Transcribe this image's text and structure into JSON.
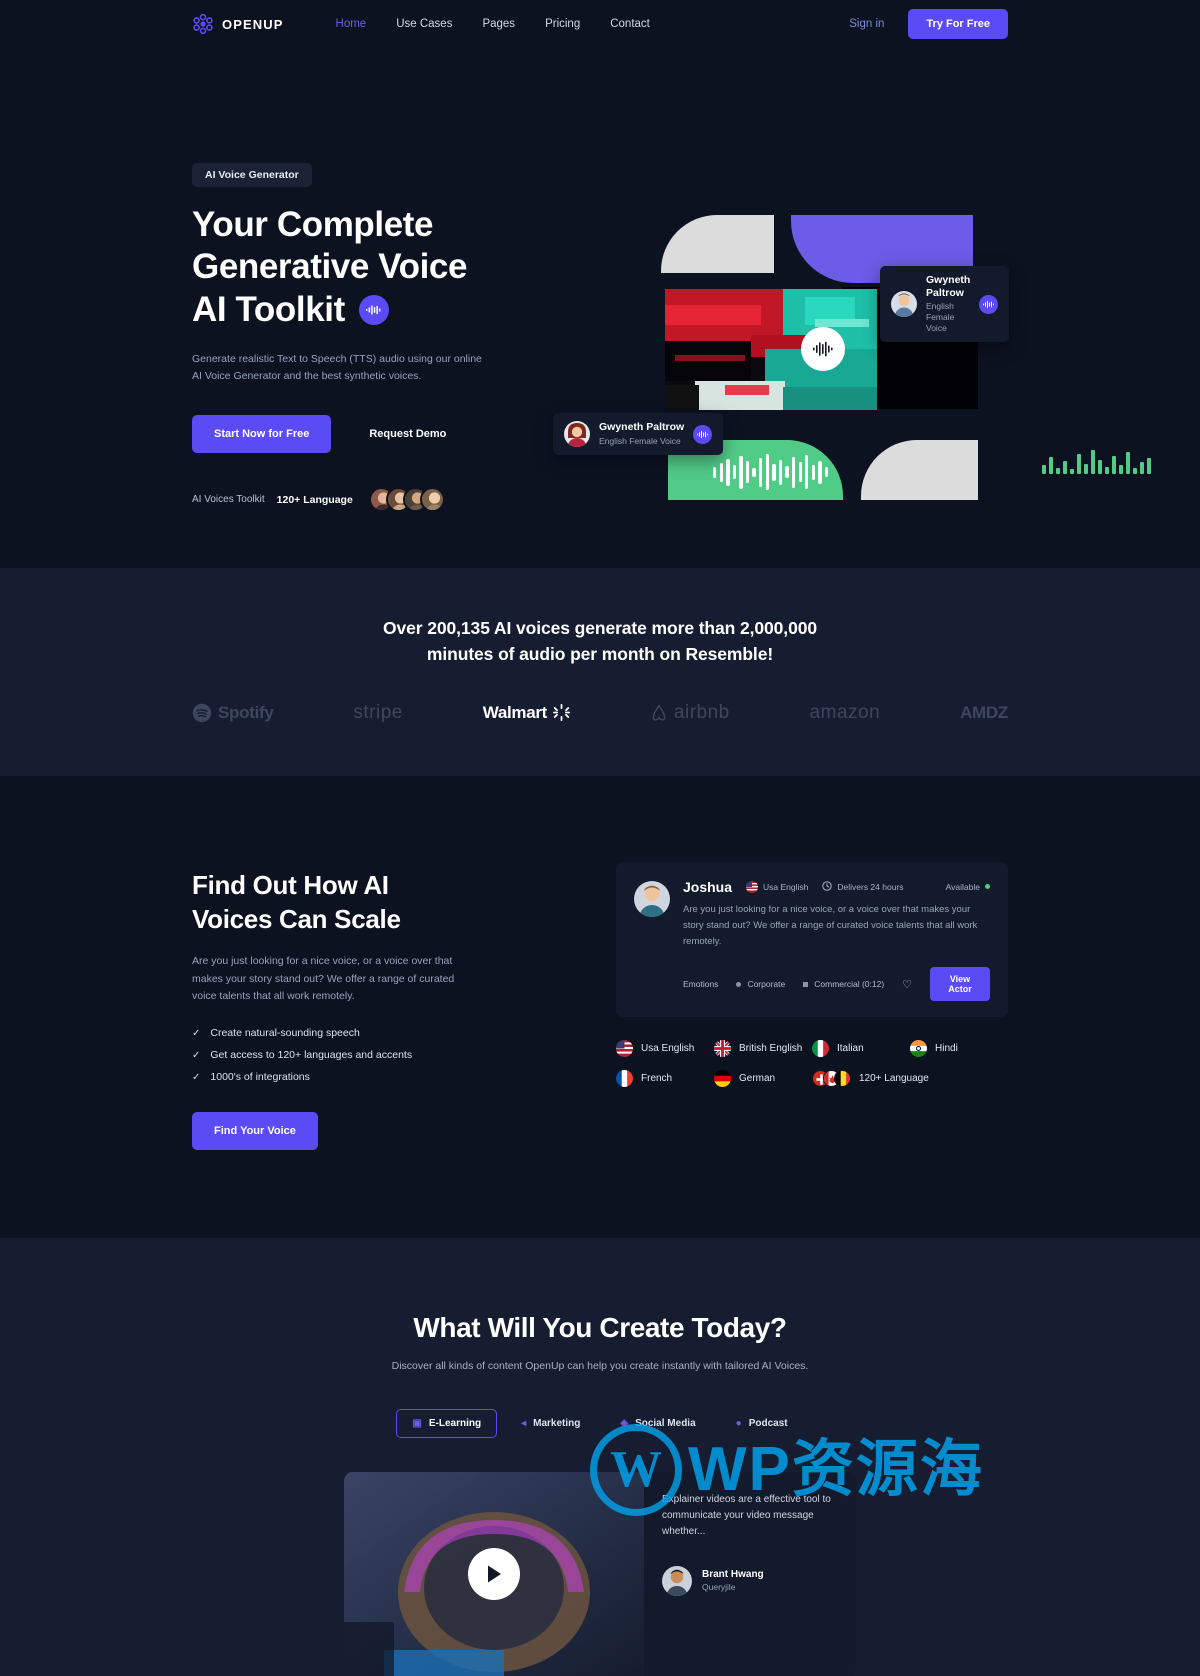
{
  "brand": {
    "name": "OPENUP",
    "logo_icon": "atom-logo-icon",
    "accent": "#5b4bf5"
  },
  "nav": {
    "links": [
      {
        "label": "Home",
        "active": true
      },
      {
        "label": "Use Cases",
        "active": false
      },
      {
        "label": "Pages",
        "active": false
      },
      {
        "label": "Pricing",
        "active": false
      },
      {
        "label": "Contact",
        "active": false
      }
    ],
    "signin_label": "Sign in",
    "cta_label": "Try For Free"
  },
  "hero": {
    "badge": "AI Voice Generator",
    "heading_line1": "Your Complete",
    "heading_line2": "Generative Voice",
    "heading_line3": "AI Toolkit",
    "heading_icon": "audio-wave-icon",
    "subtext": "Generate realistic Text to Speech (TTS) audio using our online AI Voice Generator and the best synthetic voices.",
    "primary_cta": "Start Now for Free",
    "secondary_cta": "Request Demo",
    "meta_label": "AI Voices Toolkit",
    "meta_value": "120+ Language",
    "voice_card_top": {
      "name": "Gwyneth Paltrow",
      "role": "English Female Voice",
      "icon": "audio-wave-icon"
    },
    "voice_card_bottom": {
      "name": "Gwyneth Paltrow",
      "role": "English Female Voice",
      "icon": "audio-wave-icon"
    },
    "play_icon": "audio-wave-play-icon"
  },
  "stats": {
    "line1": "Over 200,135 AI voices generate more than 2,000,000",
    "line2": "minutes of audio per month on Resemble!",
    "logos": [
      {
        "name": "Spotify",
        "highlight": false
      },
      {
        "name": "stripe",
        "highlight": false
      },
      {
        "name": "Walmart",
        "highlight": true
      },
      {
        "name": "airbnb",
        "highlight": false
      },
      {
        "name": "amazon",
        "highlight": false
      },
      {
        "name": "AMDZ",
        "highlight": false
      }
    ]
  },
  "scale": {
    "heading_line1": "Find Out How AI",
    "heading_line2": "Voices Can Scale",
    "paragraph": "Are you just looking for a nice voice, or a voice over that makes your story stand out? We offer a range of curated voice talents that all work remotely.",
    "checks": [
      "Create natural-sounding speech",
      "Get access to 120+ languages and accents",
      "1000's of integrations"
    ],
    "cta_label": "Find Your Voice",
    "actor": {
      "name": "Joshua",
      "language": "Usa English",
      "language_flag": "us-flag-icon",
      "delivery": "Delivers 24 hours",
      "delivery_icon": "clock-icon",
      "availability": "Available",
      "description": "Are you just looking for a nice voice, or a voice over that makes your story stand out? We offer a range of curated voice talents that all work remotely.",
      "tags": [
        "Emotions",
        "Corporate",
        "Commercial (0:12)"
      ],
      "favorite_icon": "heart-icon",
      "view_label": "View Actor"
    },
    "languages": [
      {
        "label": "Usa English",
        "flag": "us-flag-icon"
      },
      {
        "label": "British English",
        "flag": "uk-flag-icon"
      },
      {
        "label": "Italian",
        "flag": "italy-flag-icon"
      },
      {
        "label": "Hindi",
        "flag": "india-flag-icon"
      },
      {
        "label": "French",
        "flag": "france-flag-icon"
      },
      {
        "label": "German",
        "flag": "germany-flag-icon"
      },
      {
        "label": "120+ Language",
        "flag": "flag-stack-icon"
      }
    ]
  },
  "create": {
    "heading": "What Will You Create Today?",
    "subtext": "Discover all kinds of content OpenUp can help you create instantly with tailored AI Voices.",
    "tabs": [
      {
        "label": "E-Learning",
        "icon": "book-icon",
        "active": true
      },
      {
        "label": "Marketing",
        "icon": "megaphone-icon",
        "active": false
      },
      {
        "label": "Social Media",
        "icon": "share-icon",
        "active": false
      },
      {
        "label": "Podcast",
        "icon": "microphone-icon",
        "active": false
      }
    ],
    "video_play_icon": "play-icon",
    "quote": "Explainer videos are a effective tool to communicate your video message whether...",
    "quote_author": "Brant Hwang",
    "quote_role": "Queryjile"
  },
  "watermark": {
    "mark": "W",
    "text": "WP资源海"
  }
}
